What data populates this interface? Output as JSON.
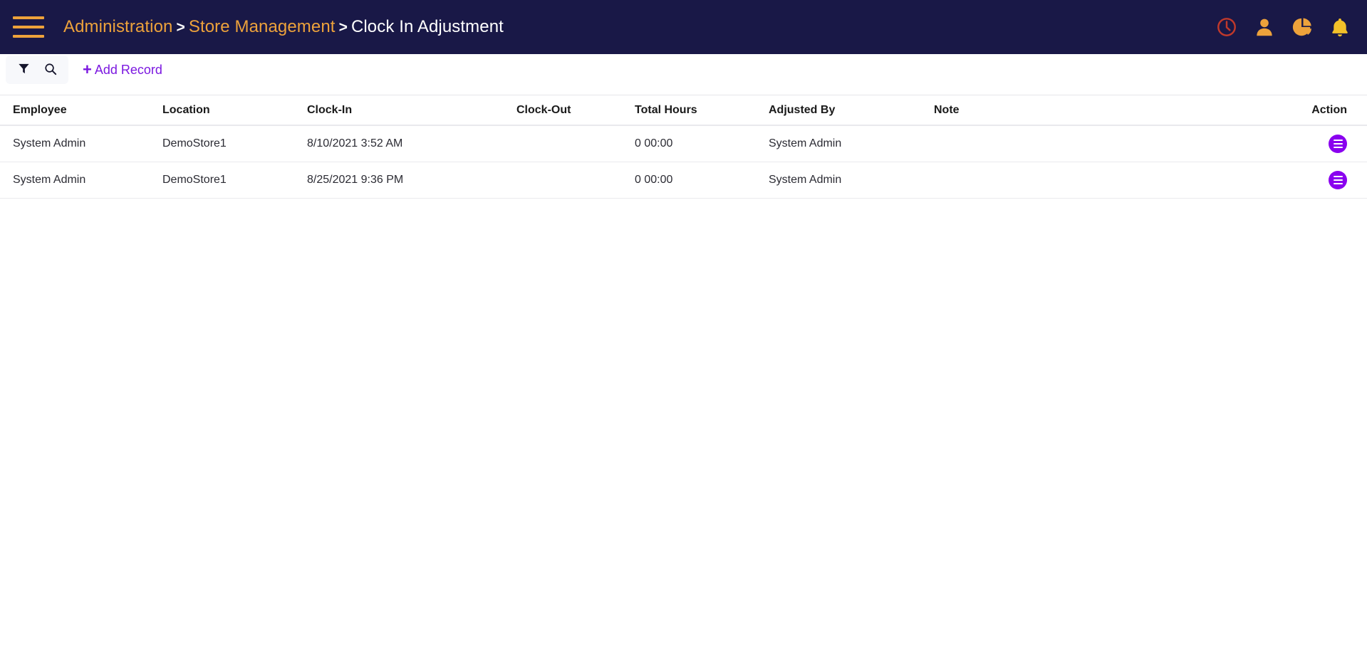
{
  "header": {
    "menu_icon": "hamburger-menu-icon",
    "breadcrumb": {
      "level1": "Administration",
      "sep1": ">",
      "level2": "Store Management",
      "sep2": ">",
      "current": "Clock In Adjustment"
    },
    "icons": [
      {
        "name": "clock-icon",
        "color": "#c0392b"
      },
      {
        "name": "user-icon",
        "color": "#eda23b"
      },
      {
        "name": "pie-chart-icon",
        "color": "#eda23b"
      },
      {
        "name": "bell-icon",
        "color": "#f2c029"
      }
    ]
  },
  "toolbar": {
    "filter_icon": "filter-icon",
    "search_icon": "search-icon",
    "add_record_label": "Add Record",
    "add_record_plus": "+",
    "accent_color": "#7b17e0"
  },
  "table": {
    "columns": [
      "Employee",
      "Location",
      "Clock-In",
      "Clock-Out",
      "Total Hours",
      "Adjusted By",
      "Note",
      "Action"
    ],
    "rows": [
      {
        "employee": "System Admin",
        "location": "DemoStore1",
        "clock_in": "8/10/2021 3:52 AM",
        "clock_out": "",
        "total_hours": "0 00:00",
        "adjusted_by": "System Admin",
        "note": "",
        "action_icon": "row-menu-icon"
      },
      {
        "employee": "System Admin",
        "location": "DemoStore1",
        "clock_in": "8/25/2021 9:36 PM",
        "clock_out": "",
        "total_hours": "0 00:00",
        "adjusted_by": "System Admin",
        "note": "",
        "action_icon": "row-menu-icon"
      }
    ]
  },
  "colors": {
    "topbar_bg": "#191847",
    "breadcrumb_link": "#eda23b",
    "action_purple": "#8a00ef"
  }
}
